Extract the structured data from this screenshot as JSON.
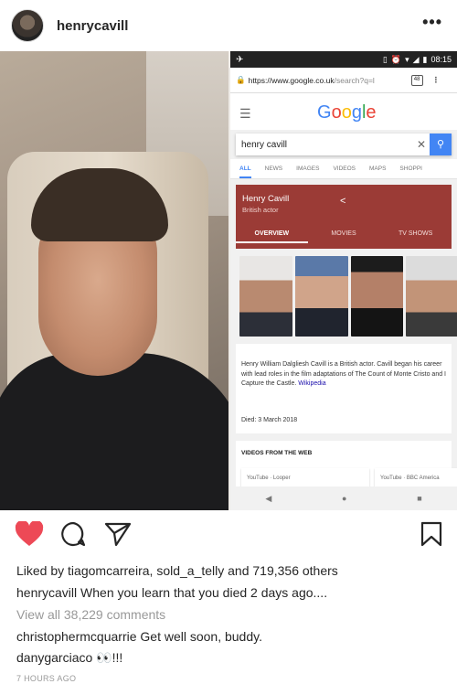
{
  "header": {
    "username": "henrycavill",
    "more_label": "•••"
  },
  "phone": {
    "status_time": "08:15",
    "url_host": "https://www.google.co.uk",
    "url_path": "/search?q=l",
    "tab_count": "48",
    "search_query": "henry cavill",
    "tabs": [
      "ALL",
      "NEWS",
      "IMAGES",
      "VIDEOS",
      "MAPS",
      "SHOPPI"
    ],
    "kp_name": "Henry Cavill",
    "kp_desc": "British actor",
    "kp_tabs": [
      "OVERVIEW",
      "MOVIES",
      "TV SHOWS"
    ],
    "bio": "Henry William Dalgliesh Cavill is a British actor. Cavill began his career with lead roles in the film adaptations of The Count of Monte Cristo and I Capture the Castle.",
    "wiki": "Wikipedia",
    "died_label": "Died:",
    "died_value": "3 March 2018",
    "videos_header": "VIDEOS FROM THE WEB",
    "video1": "YouTube · Looper",
    "video2": "YouTube · BBC America"
  },
  "post": {
    "likes_prefix": "Liked by ",
    "liker1": "tiagomcarreira",
    "liker2": "sold_a_telly",
    "likes_suffix": " and 719,356 others",
    "caption_user": "henrycavill",
    "caption_text": " When you learn that you died 2 days ago....",
    "view_all": "View all 38,229 comments",
    "comment1_user": "christophermcquarrie",
    "comment1_text": " Get well soon, buddy.",
    "comment2_user": "danygarciaco",
    "comment2_text": " 👀!!!",
    "timestamp": "7 HOURS AGO"
  },
  "colors": {
    "heart": "#ed4956",
    "kp_bg": "#9b3b36",
    "google_blue": "#4285F4"
  }
}
